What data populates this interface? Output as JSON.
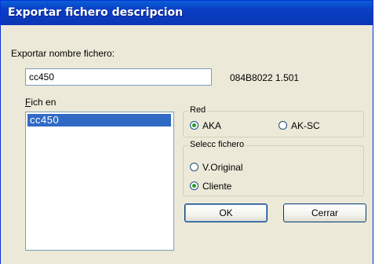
{
  "window": {
    "title": "Exportar fichero descripcion"
  },
  "export_name": {
    "label": "Exportar nombre fichero:",
    "value": "cc450",
    "version_info": "084B8022 1.501"
  },
  "file_list": {
    "label_access": "F",
    "label_rest": "ich en",
    "items": [
      "cc450"
    ],
    "selected": "cc450"
  },
  "network": {
    "legend": "Red",
    "options": [
      "AKA",
      "AK-SC"
    ],
    "selected": "AKA"
  },
  "file_select": {
    "legend": "Selecc fichero",
    "options": [
      "V.Original",
      "Cliente"
    ],
    "selected": "Cliente"
  },
  "buttons": {
    "ok": "OK",
    "close": "Cerrar"
  },
  "colors": {
    "title_bar": "#0a3fc4",
    "selection": "#316ac5",
    "dialog_bg": "#ece9d8"
  }
}
